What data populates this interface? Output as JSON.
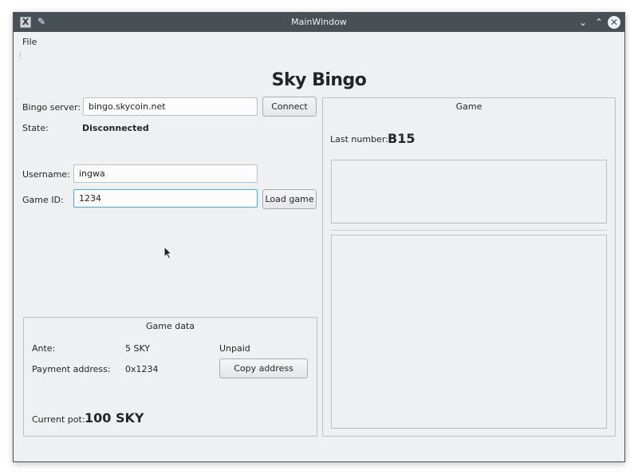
{
  "window": {
    "title": "MainWindow",
    "app_icon_glyph": "X",
    "pin_icon_glyph": "✎",
    "minimize_glyph": "⌄",
    "maximize_glyph": "⌃",
    "close_glyph": "✕"
  },
  "menubar": {
    "file_label": "File"
  },
  "app_title": "Sky Bingo",
  "connection": {
    "server_label": "Bingo server:",
    "server_value": "bingo.skycoin.net",
    "connect_button": "Connect",
    "state_label": "State:",
    "state_value": "Disconnected"
  },
  "player": {
    "username_label": "Username:",
    "username_value": "ingwa",
    "game_id_label": "Game ID:",
    "game_id_value": "1234",
    "load_button": "Load game"
  },
  "game_data": {
    "title": "Game data",
    "ante_label": "Ante:",
    "ante_value": "5 SKY",
    "paid_status": "Unpaid",
    "payment_label": "Payment address:",
    "payment_value": "0x1234",
    "copy_button": "Copy address",
    "pot_label": "Current pot:",
    "pot_value": "100 SKY"
  },
  "game": {
    "title": "Game",
    "last_number_label": "Last number:",
    "last_number_value": "B15"
  },
  "colors": {
    "titlebar": "#475057",
    "window_bg": "#eff0f1",
    "focus_accent": "#3daee9"
  }
}
